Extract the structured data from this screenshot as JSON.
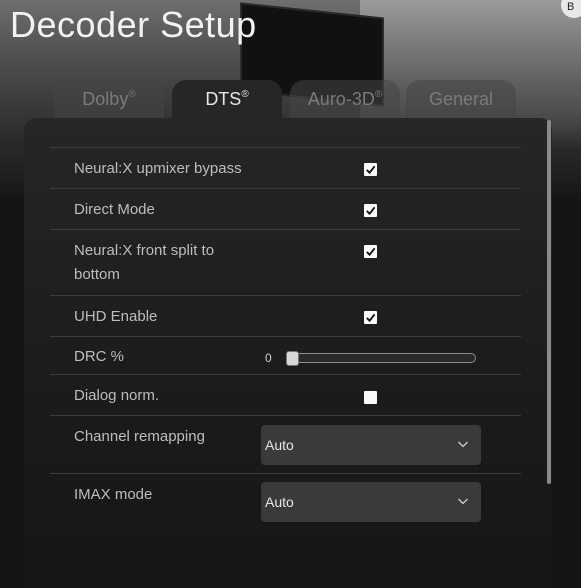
{
  "header": {
    "title": "Decoder Setup",
    "corner_badge": "B"
  },
  "tabs": [
    {
      "label": "Dolby",
      "mark": "®",
      "active": false
    },
    {
      "label": "DTS",
      "mark": "®",
      "active": true
    },
    {
      "label": "Auro-3D",
      "mark": "®",
      "active": false
    },
    {
      "label": "General",
      "mark": "",
      "active": false
    }
  ],
  "settings": {
    "neural_x_bypass": {
      "label": "Neural:X upmixer bypass",
      "checked": true
    },
    "direct_mode": {
      "label": "Direct Mode",
      "checked": true
    },
    "front_split": {
      "label_line1": "Neural:X front split to",
      "label_line2": "bottom",
      "checked": true
    },
    "uhd_enable": {
      "label": "UHD Enable",
      "checked": true
    },
    "drc": {
      "label": "DRC %",
      "value": "0",
      "level": 0
    },
    "dialog_norm": {
      "label": "Dialog norm.",
      "checked": false
    },
    "channel_remapping": {
      "label": "Channel remapping",
      "selected": "Auto"
    },
    "imax_mode": {
      "label": "IMAX mode",
      "selected": "Auto"
    }
  },
  "icons": {
    "checkmark": "check-icon",
    "dropdown": "chevron-down-icon"
  },
  "colors": {
    "accent_text": "#e6e6e6",
    "muted_text": "#7a7a7a",
    "panel": "#262626"
  }
}
